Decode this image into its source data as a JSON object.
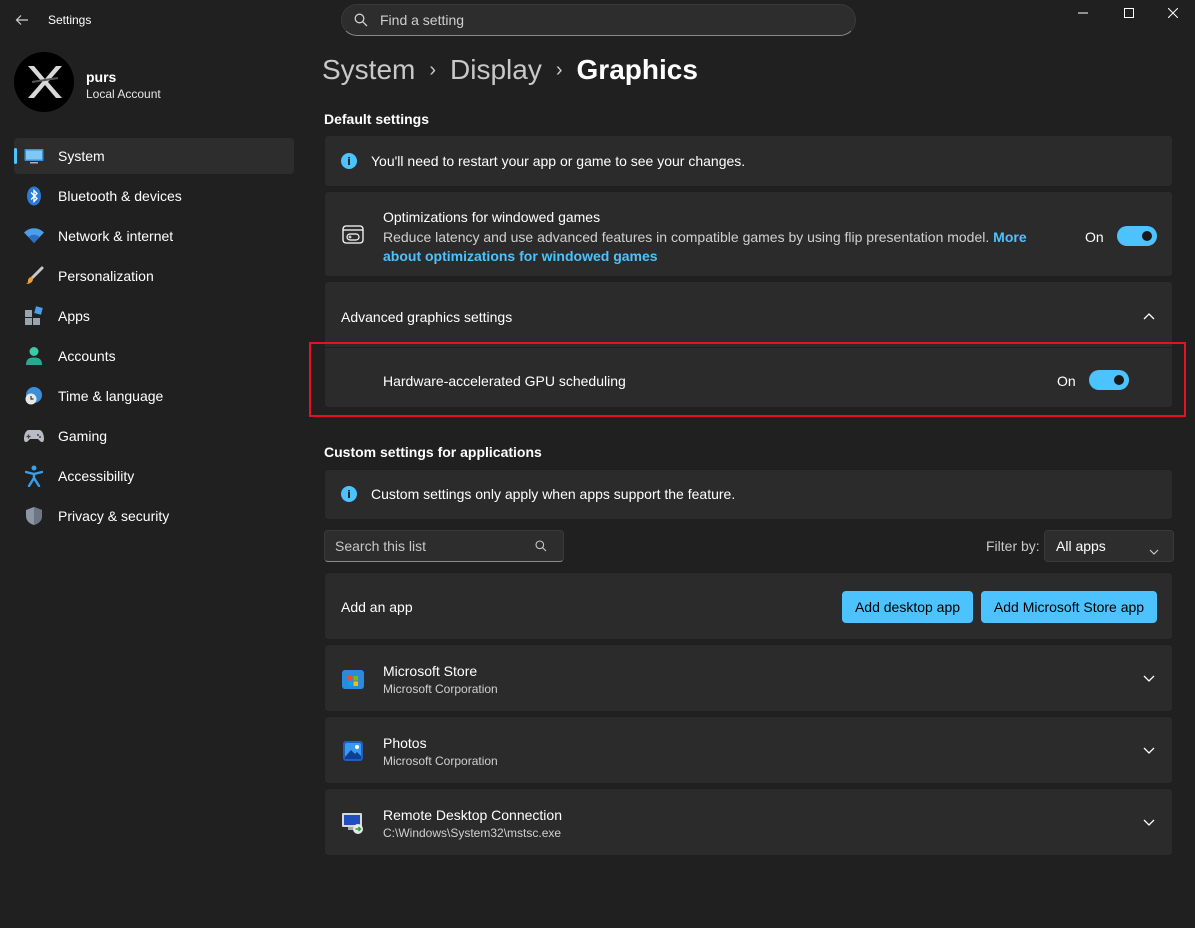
{
  "window": {
    "title": "Settings",
    "search_placeholder": "Find a setting",
    "icons": [
      "back-arrow-icon",
      "search-icon",
      "minimize-icon",
      "maximize-icon",
      "close-icon"
    ]
  },
  "profile": {
    "name": "purs",
    "account_type": "Local Account"
  },
  "sidebar": {
    "items": [
      {
        "label": "System",
        "icon": "display-icon",
        "active": true
      },
      {
        "label": "Bluetooth & devices",
        "icon": "bluetooth-icon"
      },
      {
        "label": "Network & internet",
        "icon": "wifi-icon"
      },
      {
        "label": "Personalization",
        "icon": "brush-icon"
      },
      {
        "label": "Apps",
        "icon": "apps-icon"
      },
      {
        "label": "Accounts",
        "icon": "person-icon"
      },
      {
        "label": "Time & language",
        "icon": "globe-clock-icon"
      },
      {
        "label": "Gaming",
        "icon": "gamepad-icon"
      },
      {
        "label": "Accessibility",
        "icon": "accessibility-icon"
      },
      {
        "label": "Privacy & security",
        "icon": "shield-icon"
      }
    ]
  },
  "breadcrumb": {
    "items": [
      "System",
      "Display",
      "Graphics"
    ],
    "separator": "›"
  },
  "default_settings": {
    "title": "Default settings",
    "info": "You'll need to restart your app or game to see your changes.",
    "windowed_games": {
      "title": "Optimizations for windowed games",
      "description": "Reduce latency and use advanced features in compatible games by using flip presentation model.",
      "link_part1": "More",
      "link_part2": "about optimizations for windowed games",
      "state_label": "On",
      "enabled": true
    },
    "advanced": {
      "title": "Advanced graphics settings",
      "expanded": true,
      "gpu_scheduling": {
        "label": "Hardware-accelerated GPU scheduling",
        "state_label": "On",
        "enabled": true
      }
    }
  },
  "custom_settings": {
    "title": "Custom settings for applications",
    "info": "Custom settings only apply when apps support the feature.",
    "search_placeholder": "Search this list",
    "filter_label": "Filter by:",
    "filter_value": "All apps",
    "add_app": {
      "label": "Add an app",
      "desktop_button": "Add desktop app",
      "store_button": "Add Microsoft Store app"
    },
    "apps": [
      {
        "name": "Microsoft Store",
        "publisher": "Microsoft Corporation",
        "icon": "microsoft-store-icon"
      },
      {
        "name": "Photos",
        "publisher": "Microsoft Corporation",
        "icon": "photos-icon"
      },
      {
        "name": "Remote Desktop Connection",
        "publisher": "C:\\Windows\\System32\\mstsc.exe",
        "icon": "remote-desktop-icon"
      }
    ]
  },
  "colors": {
    "accent": "#4cc2ff",
    "background": "#202020",
    "card": "#2b2b2b",
    "highlight_border": "#e81123"
  }
}
